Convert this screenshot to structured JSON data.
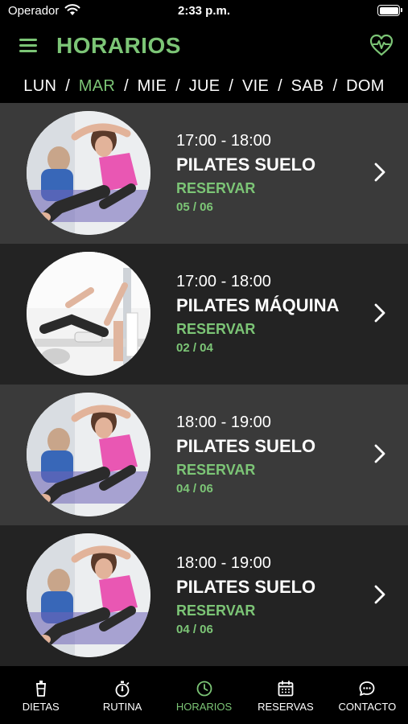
{
  "status": {
    "carrier": "Operador",
    "time": "2:33 p.m."
  },
  "header": {
    "title": "HORARIOS"
  },
  "days": [
    "LUN",
    "MAR",
    "MIE",
    "JUE",
    "VIE",
    "SAB",
    "DOM"
  ],
  "selected_day": "MAR",
  "classes": [
    {
      "time": "17:00 - 18:00",
      "name": "PILATES SUELO",
      "action": "RESERVAR",
      "slots": "05 / 06",
      "image": "pilates-floor-photo"
    },
    {
      "time": "17:00 - 18:00",
      "name": "PILATES MÁQUINA",
      "action": "RESERVAR",
      "slots": "02 / 04",
      "image": "pilates-machine-photo"
    },
    {
      "time": "18:00 - 19:00",
      "name": "PILATES SUELO",
      "action": "RESERVAR",
      "slots": "04 / 06",
      "image": "pilates-floor-photo"
    },
    {
      "time": "18:00 - 19:00",
      "name": "PILATES SUELO",
      "action": "RESERVAR",
      "slots": "04 / 06",
      "image": "pilates-floor-photo"
    }
  ],
  "tabs": [
    {
      "label": "DIETAS",
      "icon": "cup-icon"
    },
    {
      "label": "RUTINA",
      "icon": "stopwatch-icon"
    },
    {
      "label": "HORARIOS",
      "icon": "clock-icon"
    },
    {
      "label": "RESERVAS",
      "icon": "calendar-icon"
    },
    {
      "label": "CONTACTO",
      "icon": "chat-icon"
    }
  ],
  "active_tab": "HORARIOS",
  "colors": {
    "accent": "#7cc576",
    "row_light": "#3a3a3a",
    "row_dark": "#232323",
    "background": "#000000"
  }
}
